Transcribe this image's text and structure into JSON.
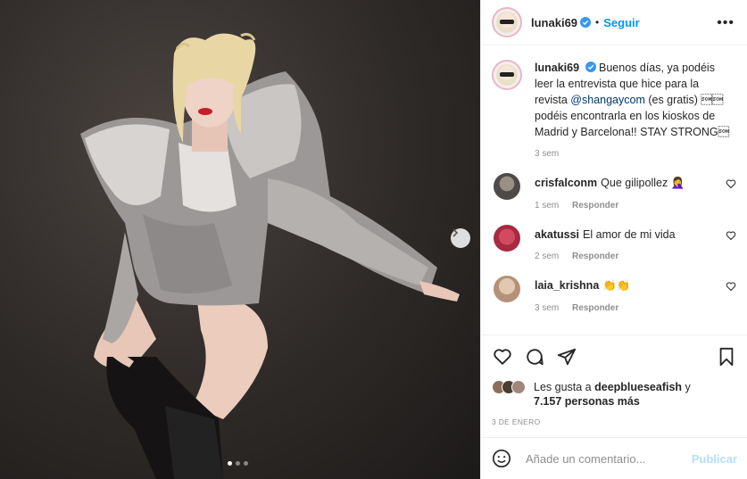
{
  "post": {
    "username": "lunaki69",
    "follow_label": "Seguir",
    "separator": "•",
    "more_label": "•••",
    "caption_text": "Buenos días, ya podéis leer la entrevista que hice para la revista ",
    "caption_mention": "@shangaycom",
    "caption_rest": " (es gratis) \u0001\u0001 podéis encontrarla en los kioskos de Madrid y Barcelona!! STAY STRONG\u0001",
    "caption_time": "3 sem"
  },
  "comments": [
    {
      "user": "crisfalconm",
      "text": "Que gilipollez 🤦‍♀️",
      "time": "1 sem",
      "reply": "Responder",
      "avatar_color": "#6b6a68"
    },
    {
      "user": "akatussi",
      "text": "El amor de mi vida",
      "time": "2 sem",
      "reply": "Responder",
      "avatar_color": "#b0304a"
    },
    {
      "user": "laia_krishna",
      "text": "👏👏",
      "time": "3 sem",
      "reply": "Responder",
      "avatar_color": "#c9a88c"
    }
  ],
  "likes": {
    "prefix": "Les gusta a ",
    "user": "deepblueseafish",
    "middle": " y",
    "count": "7.157 personas más"
  },
  "date": "3 DE ENERO",
  "add_comment": {
    "placeholder": "Añade un comentario...",
    "publish_label": "Publicar"
  },
  "colors": {
    "accent": "#0095f6",
    "publish_disabled": "#b2dffc",
    "verified": "#3897f0"
  },
  "carousel": {
    "current": 1,
    "total": 3
  }
}
